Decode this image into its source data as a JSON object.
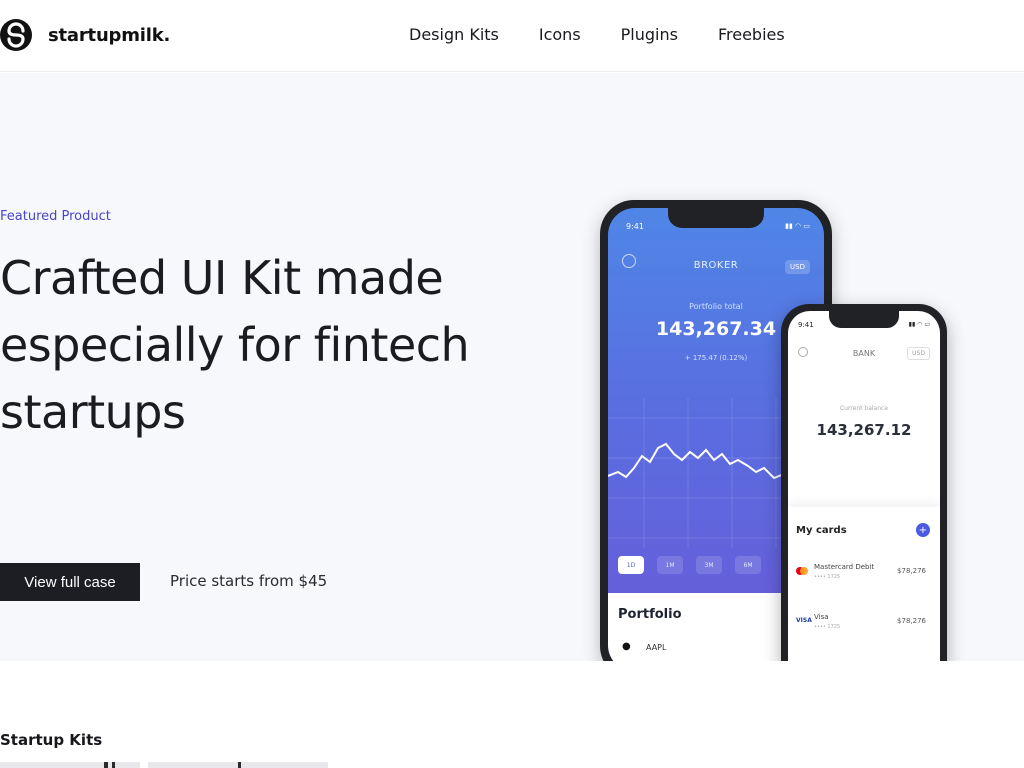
{
  "header": {
    "logo_text": "startupmilk.",
    "nav": [
      "Design Kits",
      "Icons",
      "Plugins",
      "Freebies"
    ]
  },
  "hero": {
    "eyebrow": "Featured Product",
    "headline": "Crafted UI Kit made especially for fintech startups",
    "cta_label": "View full case",
    "price_text": "Price starts from $45",
    "accent_color": "#4b44c7",
    "background": "#f7f8fc"
  },
  "phone_broker": {
    "time": "9:41",
    "title": "BROKER",
    "currency": "USD",
    "portfolio_label": "Portfolio total",
    "portfolio_value": "143,267.34",
    "change": "+ 175.47 (0.12%)",
    "ranges": [
      "1D",
      "1M",
      "3M",
      "6M"
    ],
    "active_range": "1D",
    "portfolio_title": "Portfolio",
    "holding": "AAPL"
  },
  "phone_bank": {
    "time": "9:41",
    "title": "BANK",
    "currency": "USD",
    "balance_label": "Current balance",
    "balance_value": "143,267.12",
    "cards_title": "My cards",
    "cards": [
      {
        "name": "Mastercard Debit",
        "sub": "•••• 1725",
        "amount": "$78,276"
      },
      {
        "name": "Visa",
        "sub": "•••• 1725",
        "amount": "$78,276"
      }
    ]
  },
  "section": {
    "title": "Startup Kits"
  }
}
